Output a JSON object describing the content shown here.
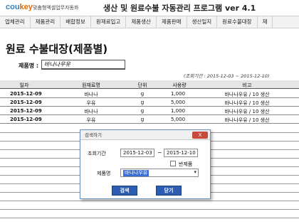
{
  "header": {
    "logo_main": "cou",
    "logo_accent": "key",
    "logo_sub": "맞춤형엑셀업무자동화",
    "app_title": "생산 및 원료수불 자동관리 프로그램 ver 4.1"
  },
  "menu": [
    "업체관리",
    "제품관리",
    "배합정보",
    "원재료입고",
    "제품생산",
    "제품판매",
    "생산일지",
    "원료수불대장",
    "재"
  ],
  "page": {
    "title": "원료 수불대장(제품별)",
    "product_label": "제품명 :",
    "product_value": "바나나우유",
    "period_text": "(조회기간 : 2015-12-03 ~ 2015-12-10)"
  },
  "table": {
    "headers": [
      "일자",
      "원재료명",
      "단위",
      "사용량",
      "비고"
    ],
    "rows": [
      {
        "date": "2015-12-09",
        "name": "바나나",
        "unit": "g",
        "qty": "1,000",
        "note": "바나나우유 / 10 생산"
      },
      {
        "date": "2015-12-09",
        "name": "우유",
        "unit": "g",
        "qty": "5,000",
        "note": "바나나우유 / 10 생산"
      },
      {
        "date": "2015-12-09",
        "name": "바나나",
        "unit": "g",
        "qty": "1,000",
        "note": "바나나우유 / 10 생산"
      },
      {
        "date": "2015-12-09",
        "name": "우유",
        "unit": "g",
        "qty": "5,000",
        "note": "바나나우유 / 10 생산"
      }
    ]
  },
  "dialog": {
    "title": "검색하기",
    "close_label": "X",
    "period_label": "조회기간",
    "date_from": "2015-12-03",
    "tilde": "~",
    "date_to": "2015-12-10",
    "checkbox_label": "반제품",
    "product_label": "제품명",
    "product_value": "바나나우유",
    "dropdown_arrow": "▾",
    "search_button": "검색",
    "close_button": "닫기"
  }
}
